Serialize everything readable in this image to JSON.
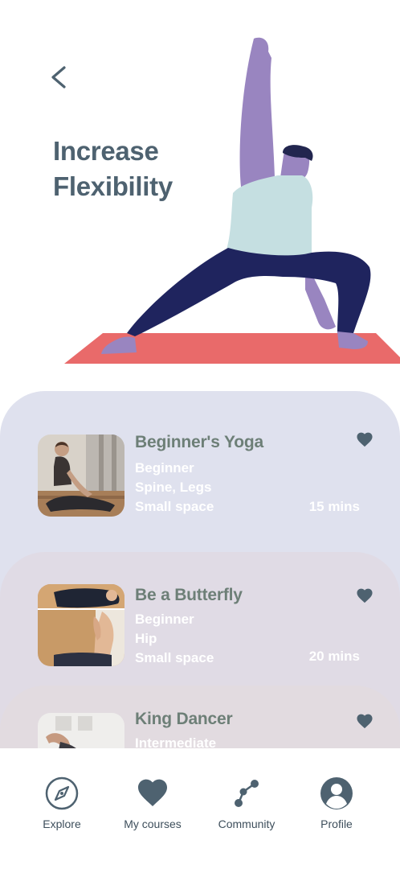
{
  "header": {
    "title": "Increase Flexibility"
  },
  "courses": [
    {
      "title": "Beginner's Yoga",
      "level": "Beginner",
      "focus": "Spine, Legs",
      "space": "Small space",
      "duration": "15 mins"
    },
    {
      "title": "Be a Butterfly",
      "level": "Beginner",
      "focus": "Hip",
      "space": "Small space",
      "duration": "20 mins"
    },
    {
      "title": "King Dancer",
      "level": "Intermediate"
    }
  ],
  "nav": {
    "items": [
      {
        "label": "Explore"
      },
      {
        "label": "My courses"
      },
      {
        "label": "Community"
      },
      {
        "label": "Profile"
      }
    ]
  },
  "colors": {
    "accent": "#4e6270",
    "figure": "#9985c0",
    "mat": "#e96a6a",
    "pants": "#1f245e"
  }
}
